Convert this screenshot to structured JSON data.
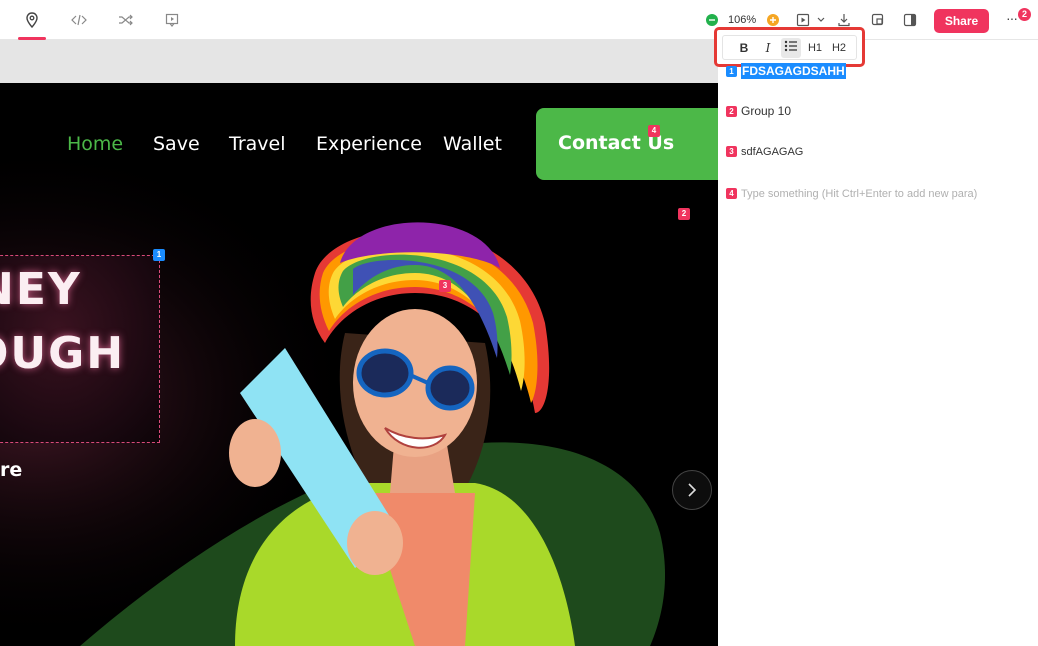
{
  "toolbar": {
    "left_icons": [
      "location-pin-icon",
      "code-icon",
      "shuffle-icon",
      "comment-frame-icon"
    ],
    "zoom": "106%",
    "share_label": "Share",
    "more_badge": "2",
    "accent": "#f0345e"
  },
  "canvas": {
    "nav": [
      "Home",
      "Save",
      "Travel",
      "Experience",
      "Wallet"
    ],
    "contact_label": "Contact Us",
    "headline_line1": "NEY",
    "headline_line2": "OUGH",
    "sub_text": "re",
    "pins": {
      "p1": "1",
      "p2": "2",
      "p3": "3",
      "p4": "4"
    },
    "nav_active_color": "#4cb848"
  },
  "format_toolbar": {
    "bold": "B",
    "italic": "I",
    "h1": "H1",
    "h2": "H2"
  },
  "notes": [
    {
      "num": "1",
      "text": "FDSAGAGDSAHH"
    },
    {
      "num": "2",
      "text": "Group 10"
    },
    {
      "num": "3",
      "text": "sdfAGAGAG"
    },
    {
      "num": "4",
      "text": "Type something  (Hit Ctrl+Enter to add new para)"
    }
  ]
}
